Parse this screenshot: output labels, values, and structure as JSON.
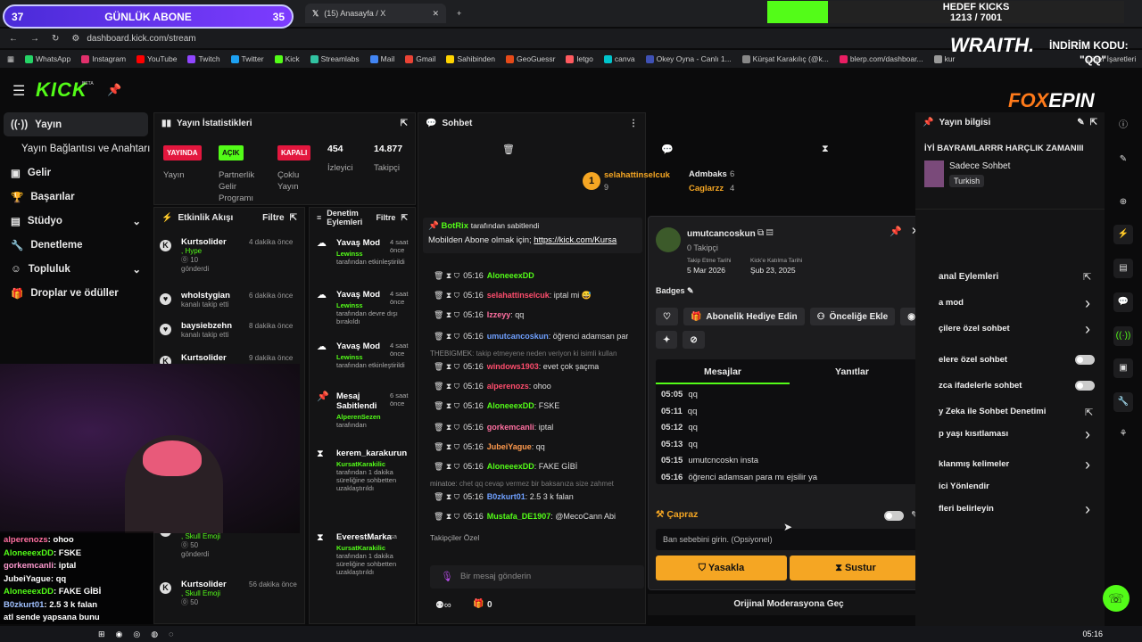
{
  "goal": {
    "left": "37",
    "label": "GÜNLÜK ABONE",
    "right": "35"
  },
  "tabs": [
    {
      "label": "(15) Anasayfa / X"
    }
  ],
  "hedef": {
    "title": "HEDEF KICKS",
    "value": "1213 / 7001",
    "progress_fraction": 0.17
  },
  "address": "dashboard.kick.com/stream",
  "bookmarks": [
    "WhatsApp",
    "Instagram",
    "YouTube",
    "Twitch",
    "Twitter",
    "Kick",
    "Streamlabs",
    "Mail",
    "Gmail",
    "Sahibinden",
    "GeoGuessr",
    "letgo",
    "canva",
    "Okey Oyna - Canlı 1...",
    "Kürşat Karakılıç (@k...",
    "blerp.com/dashboar...",
    "kur"
  ],
  "bookmarks_end": "Diğer İşaretleri",
  "sponsor": {
    "wraith": "WRAITH.",
    "indirim": "İNDİRİM KODU:",
    "code": "\"QQ\"",
    "foxepin_a": "FOX",
    "foxepin_b": "EPIN"
  },
  "brand": "KICK",
  "beta": "BETA",
  "sidebar": [
    {
      "label": "Yayın"
    },
    {
      "label": "Yayın Bağlantısı ve Anahtarı"
    },
    {
      "label": "Gelir"
    },
    {
      "label": "Başarılar"
    },
    {
      "label": "Stüdyo"
    },
    {
      "label": "Denetleme"
    },
    {
      "label": "Topluluk"
    },
    {
      "label": "Droplar ve ödüller"
    }
  ],
  "stats": {
    "title": "Yayın İstatistikleri",
    "yayinda": "YAYINDA",
    "yayin": "Yayın",
    "acik": "AÇIK",
    "partner": "Partnerlik Gelir Programı",
    "kapali": "KAPALI",
    "coklu": "Çoklu Yayın",
    "izleyici_n": "454",
    "izleyici": "İzleyici",
    "takipci_n": "14.877",
    "takipci": "Takipçi"
  },
  "events": {
    "title": "Etkinlik Akışı",
    "filter": "Filtre",
    "items": [
      {
        "name": "Kurtsolider",
        "time": "4 dakika önce",
        "sub": ", Hype",
        "count": "10",
        "extra": "gönderdi"
      },
      {
        "name": "wholstygian",
        "time": "6 dakika önce",
        "sub": "kanalı takip etti"
      },
      {
        "name": "baysiebzehn",
        "time": "8 dakika önce",
        "sub": "kanalı takip etti"
      },
      {
        "name": "Kurtsolider",
        "time": "9 dakika önce",
        "sub": ""
      },
      {
        "name": "Kurtsolider",
        "time": "55 dakika önce",
        "sub": ", Skull Emoji",
        "count": "50",
        "extra": "gönderdi"
      },
      {
        "name": "Kurtsolider",
        "time": "56 dakika önce",
        "sub": ", Skull Emoji",
        "count": "50",
        "extra": ""
      }
    ]
  },
  "mod": {
    "title": "Denetim Eylemleri",
    "filter": "Filtre",
    "items": [
      {
        "action": "Yavaş Mod",
        "time": "4 saat önce",
        "by": "Lewinss",
        "desc": "tarafından etkinleştirildi"
      },
      {
        "action": "Yavaş Mod",
        "time": "4 saat önce",
        "by": "Lewinss",
        "desc": "tarafından devre dışı bırakıldı"
      },
      {
        "action": "Yavaş Mod",
        "time": "4 saat önce",
        "by": "Lewinss",
        "desc": "tarafından etkinleştirildi"
      },
      {
        "action": "Mesaj Sabitlendi",
        "time": "6 saat önce",
        "by": "AlperenSezen",
        "desc": "tarafından"
      },
      {
        "action": "kerem_karakurun",
        "time": "",
        "by": "KursatKarakilic",
        "desc": "tarafından 1 dakika süreliğine sohbetten uzaklaştırıldı"
      },
      {
        "action": "EverestMarka",
        "time": "sa",
        "by": "KursatKarakilic",
        "desc": "tarafından 1 dakika süreliğine sohbetten uzaklaştırıldı"
      }
    ]
  },
  "chat": {
    "title": "Sohbet",
    "top1": "selahattinselcuk",
    "top1_n": "9",
    "top2": "Admbaks",
    "top2_n": "6",
    "top3": "Caglarzz",
    "top3_n": "4",
    "pinned_by": "BotRix",
    "pinned_suffix": "tarafından sabitlendi",
    "pinned_text": "Mobilden Abone olmak için;",
    "pinned_link": "https://kick.com/Kursa",
    "lines": [
      {
        "time": "05:16",
        "user": "AloneeexDD",
        "color": "#53fc18",
        "text": ""
      },
      {
        "time": "05:16",
        "user": "selahattinselcuk",
        "color": "#ff4d6d",
        "text": ": iptal mi 😅"
      },
      {
        "time": "05:16",
        "user": "Izzeyy",
        "color": "#ff6fa0",
        "text": ": qq"
      },
      {
        "time": "05:16",
        "user": "umutcancoskun",
        "color": "#6fa0ff",
        "text": ": öğrenci adamsan par"
      },
      {
        "time": "",
        "user": "THEBIGMEK",
        "color": "#888",
        "text": ": takip etmeyene neden veriyon ki isimli kullan"
      },
      {
        "time": "05:16",
        "user": "windows1903",
        "color": "#ff4d6d",
        "text": ": evet çok şaçma"
      },
      {
        "time": "05:16",
        "user": "alperenozs",
        "color": "#ff4d6d",
        "text": ": ohoo"
      },
      {
        "time": "05:16",
        "user": "AloneeexDD",
        "color": "#53fc18",
        "text": ": FSKE"
      },
      {
        "time": "05:16",
        "user": "gorkemcanli",
        "color": "#ff6fa0",
        "text": ": iptal"
      },
      {
        "time": "05:16",
        "user": "JubeiYague",
        "color": "#ff9a4d",
        "text": ": qq"
      },
      {
        "time": "05:16",
        "user": "AloneeexDD",
        "color": "#53fc18",
        "text": ": FAKE GİBİ"
      },
      {
        "time": "",
        "user": "minatoe",
        "color": "#888",
        "text": ": chet qq cevap vermez bir baksanıza size zahmet"
      },
      {
        "time": "05:16",
        "user": "B0zkurt01",
        "color": "#6fa0ff",
        "text": ": 2.5 3 k falan"
      },
      {
        "time": "05:16",
        "user": "Mustafa_DE1907",
        "color": "#53fc18",
        "text": ": @MecoCann Abi"
      }
    ],
    "followers": "Takipçiler Özel",
    "placeholder": "Bir mesaj gönderin",
    "viewer_count": "0"
  },
  "popup": {
    "username": "umutcancoskun",
    "followers": "0 Takipçi",
    "follow_label": "Takip Etme Tarihi",
    "follow_date": "5 Mar 2026",
    "join_label": "Kick'e Katılma Tarihi",
    "join_date": "Şub 23, 2025",
    "badges": "Badges",
    "gift": "Abonelik Hediye Edin",
    "priority": "Önceliğe Ekle",
    "tab_messages": "Mesajlar",
    "tab_replies": "Yanıtlar",
    "messages": [
      {
        "t": "05:05",
        "m": "qq"
      },
      {
        "t": "05:11",
        "m": "qq"
      },
      {
        "t": "05:12",
        "m": "qq"
      },
      {
        "t": "05:13",
        "m": "qq"
      },
      {
        "t": "05:15",
        "m": "umutcncoskn insta"
      },
      {
        "t": "05:16",
        "m": "öğrenci adamsan para mı ejsilir ya"
      }
    ],
    "capraz": "Çapraz",
    "ban_placeholder": "Ban sebebini girin. (Opsiyonel)",
    "ban": "Yasakla",
    "mute": "Sustur",
    "original": "Orijinal Moderasyona Geç"
  },
  "info": {
    "title": "Yayın bilgisi",
    "stream_title": "İYİ BAYRAMLARRR HARÇLIK ZAMANIII",
    "category": "Sadece Sohbet",
    "lang": "Turkish"
  },
  "channel": {
    "title": "anal Eylemleri",
    "rows": [
      "a mod",
      "çilere özel sohbet",
      "elere özel sohbet",
      "zca ifadelerle sohbet",
      "y Zeka ile Sohbet Denetimi",
      "p yaşı kısıtlaması",
      "klanmış kelimeler",
      "ici Yönlendir",
      "fleri belirleyin"
    ]
  },
  "overlay_chat": [
    {
      "u": "alperenozs",
      "c": "#ff6fa0",
      "t": ": ohoo"
    },
    {
      "u": "AloneeexDD",
      "c": "#53fc18",
      "t": ": FSKE"
    },
    {
      "u": "gorkemcanli",
      "c": "#ff9ad0",
      "t": ": iptal"
    },
    {
      "u": "JubeiYague",
      "c": "#ffffff",
      "t": ": qq"
    },
    {
      "u": "AloneeexDD",
      "c": "#53fc18",
      "t": ": FAKE GİBİ"
    },
    {
      "u": "B0zkurt01",
      "c": "#a0c0ff",
      "t": ": 2.5 3 k falan"
    },
    {
      "u": "atl",
      "c": "#ffffff",
      "t": " sende yapsana bunu"
    }
  ],
  "taskbar": {
    "time": "05:16"
  },
  "colors": {
    "accent": "#53fc18",
    "ban": "#f5a623",
    "live": "#e3173e",
    "brand_purple": "#7d3cff"
  }
}
